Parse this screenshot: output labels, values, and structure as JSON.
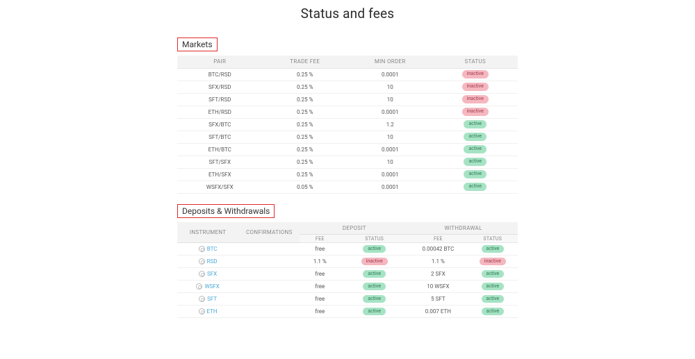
{
  "title": "Status and fees",
  "markets": {
    "heading": "Markets",
    "columns": {
      "pair": "PAIR",
      "fee": "TRADE FEE",
      "min": "MIN ORDER",
      "status": "STATUS"
    },
    "rows": [
      {
        "pair": "BTC/RSD",
        "fee": "0.25 %",
        "min": "0.0001",
        "status": "inactive"
      },
      {
        "pair": "SFX/RSD",
        "fee": "0.25 %",
        "min": "10",
        "status": "inactive"
      },
      {
        "pair": "SFT/RSD",
        "fee": "0.25 %",
        "min": "10",
        "status": "inactive"
      },
      {
        "pair": "ETH/RSD",
        "fee": "0.25 %",
        "min": "0.0001",
        "status": "inactive"
      },
      {
        "pair": "SFX/BTC",
        "fee": "0.25 %",
        "min": "1.2",
        "status": "active"
      },
      {
        "pair": "SFT/BTC",
        "fee": "0.25 %",
        "min": "10",
        "status": "active"
      },
      {
        "pair": "ETH/BTC",
        "fee": "0.25 %",
        "min": "0.0001",
        "status": "active"
      },
      {
        "pair": "SFT/SFX",
        "fee": "0.25 %",
        "min": "10",
        "status": "active"
      },
      {
        "pair": "ETH/SFX",
        "fee": "0.25 %",
        "min": "0.0001",
        "status": "active"
      },
      {
        "pair": "WSFX/SFX",
        "fee": "0.05 %",
        "min": "0.0001",
        "status": "active"
      }
    ]
  },
  "dw": {
    "heading": "Deposits & Withdrawals",
    "columns": {
      "instrument": "INSTRUMENT",
      "confirmations": "CONFIRMATIONS",
      "deposit": "DEPOSIT",
      "withdrawal": "WITHDRAWAL",
      "fee": "FEE",
      "status": "STATUS"
    },
    "rows": [
      {
        "instrument": "BTC",
        "confirmations": "",
        "dep_fee": "free",
        "dep_status": "active",
        "wd_fee": "0.00042 BTC",
        "wd_status": "active"
      },
      {
        "instrument": "RSD",
        "confirmations": "",
        "dep_fee": "1.1 %",
        "dep_status": "inactive",
        "wd_fee": "1.1 %",
        "wd_status": "inactive"
      },
      {
        "instrument": "SFX",
        "confirmations": "",
        "dep_fee": "free",
        "dep_status": "active",
        "wd_fee": "2 SFX",
        "wd_status": "active"
      },
      {
        "instrument": "WSFX",
        "confirmations": "",
        "dep_fee": "free",
        "dep_status": "active",
        "wd_fee": "10 WSFX",
        "wd_status": "active"
      },
      {
        "instrument": "SFT",
        "confirmations": "",
        "dep_fee": "free",
        "dep_status": "active",
        "wd_fee": "5 SFT",
        "wd_status": "active"
      },
      {
        "instrument": "ETH",
        "confirmations": "",
        "dep_fee": "free",
        "dep_status": "active",
        "wd_fee": "0.007 ETH",
        "wd_status": "active"
      }
    ]
  },
  "badge_labels": {
    "active": "active",
    "inactive": "inactive"
  }
}
